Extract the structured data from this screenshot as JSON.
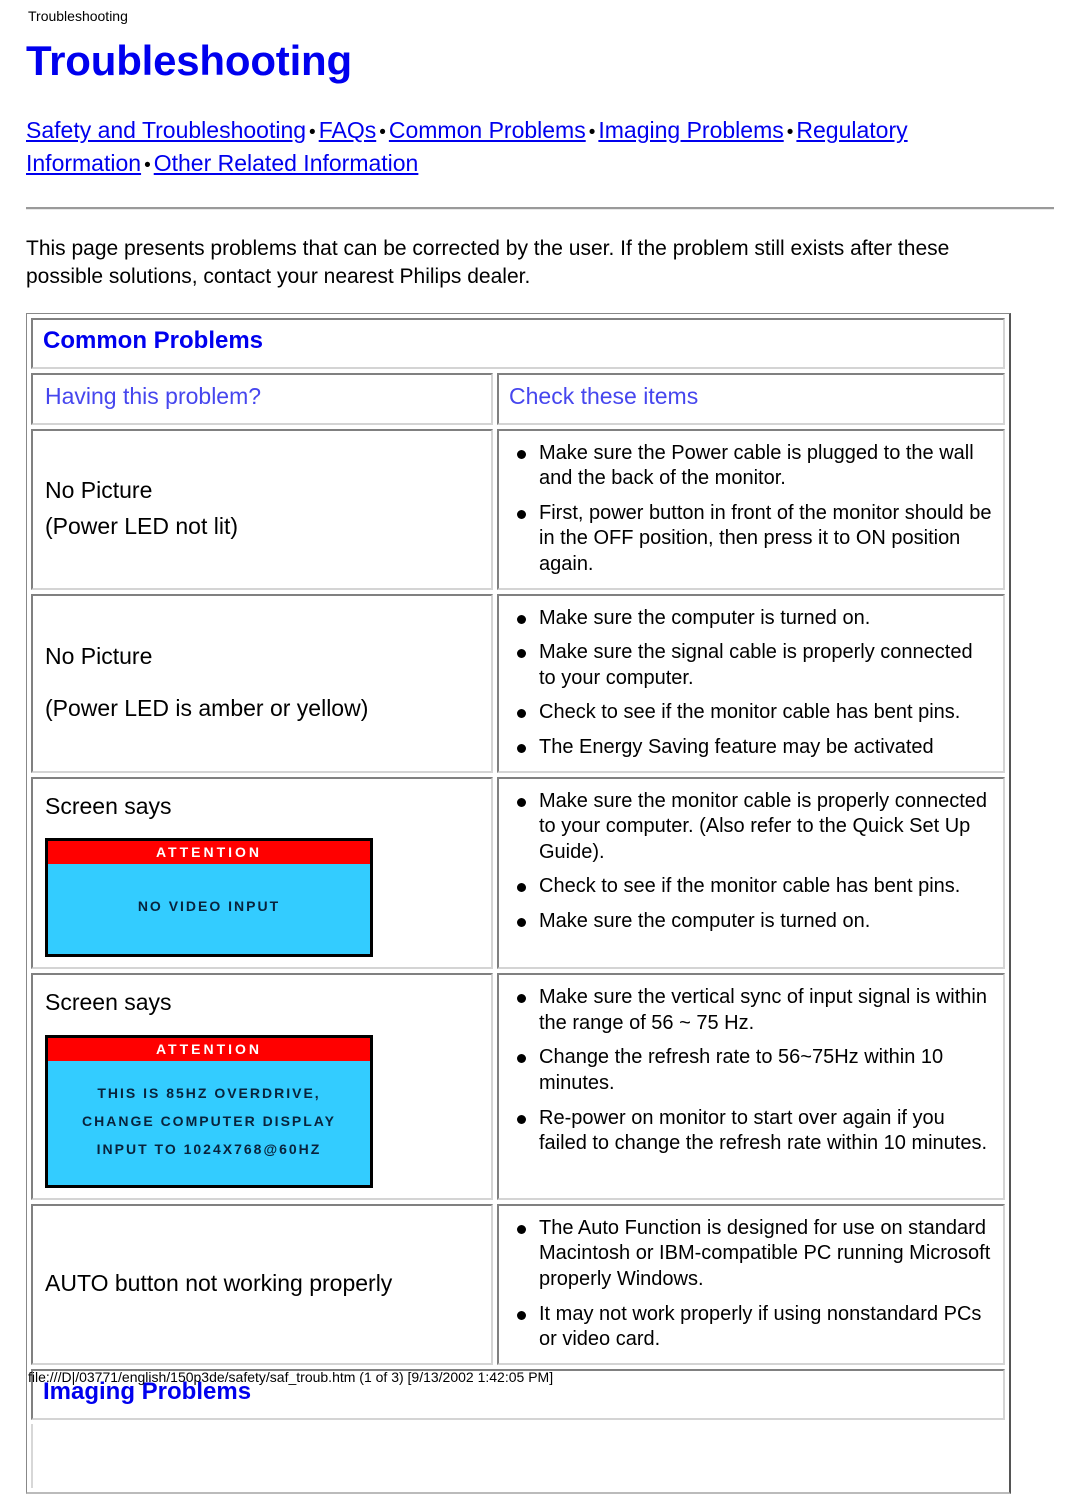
{
  "browser": {
    "window_title": "Troubleshooting",
    "status_url": "file:///D|/03771/english/150p3de/safety/saf_troub.htm (1 of 3) [9/13/2002 1:42:05 PM]"
  },
  "page": {
    "title": "Troubleshooting",
    "intro": "This page presents problems that can be corrected by the user. If the problem still exists after these possible solutions, contact your nearest Philips dealer."
  },
  "nav": {
    "separator": "•",
    "links": [
      "Safety and Troubleshooting",
      "FAQs",
      "Common Problems",
      "Imaging Problems",
      "Regulatory Information",
      "Other Related Information"
    ]
  },
  "colors": {
    "link": "#0000EE",
    "heading": "#0000EE",
    "column_header": "#4646EE",
    "osd_bar": "#FF0000",
    "osd_screen": "#33CCFF",
    "osd_text": "#08233C"
  },
  "tables": {
    "common_problems": {
      "section_title": "Common Problems",
      "columns": {
        "left": "Having this problem?",
        "right": "Check these items"
      },
      "rows": [
        {
          "problem_lines": [
            "No Picture",
            "(Power LED not lit)"
          ],
          "osd": null,
          "checks": [
            "Make sure the Power cable is plugged to the wall and the back of the monitor.",
            "First, power button in front of the monitor should be in the OFF position, then press it to ON position again."
          ]
        },
        {
          "problem_lines": [
            "No Picture",
            "(Power LED is amber or yellow)"
          ],
          "osd": null,
          "checks": [
            "Make sure the computer is turned on.",
            "Make sure the signal cable is properly connected to your computer.",
            "Check to see if the monitor cable has bent pins.",
            "The Energy Saving feature may be activated"
          ]
        },
        {
          "problem_lines": [
            "Screen says"
          ],
          "osd": {
            "bar": "ATTENTION",
            "lines": [
              "NO VIDEO INPUT"
            ]
          },
          "checks": [
            "Make sure the monitor cable is properly connected to your computer. (Also refer to the Quick Set Up Guide).",
            "Check to see if the monitor cable has bent pins.",
            "Make sure the computer is turned on."
          ]
        },
        {
          "problem_lines": [
            "Screen says"
          ],
          "osd": {
            "bar": "ATTENTION",
            "lines": [
              "THIS IS 85HZ OVERDRIVE,",
              "CHANGE COMPUTER DISPLAY",
              "INPUT TO 1024X768@60HZ"
            ]
          },
          "checks": [
            "Make sure the vertical sync of input signal is within the range of 56 ~ 75 Hz.",
            "Change the refresh rate to 56~75Hz within 10 minutes.",
            "Re-power on monitor to start over again if you failed to change the refresh rate within 10 minutes."
          ]
        },
        {
          "problem_lines": [
            "AUTO button not working properly"
          ],
          "osd": null,
          "checks": [
            "The Auto Function is designed for use on standard Macintosh or IBM-compatible PC running Microsoft properly Windows.",
            "It may not work properly if using nonstandard PCs or video card."
          ]
        }
      ]
    },
    "imaging_problems": {
      "section_title": "Imaging Problems"
    }
  }
}
